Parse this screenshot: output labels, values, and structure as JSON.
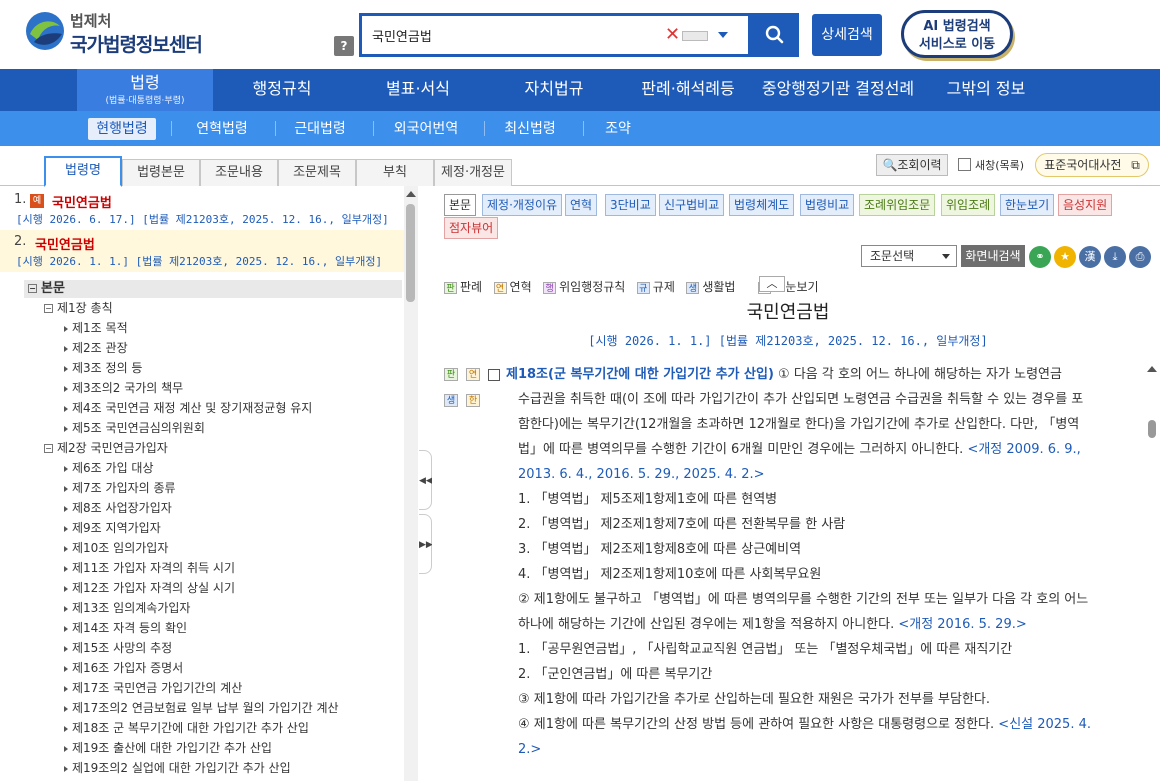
{
  "header": {
    "org": "법제처",
    "site_title": "국가법령정보센터",
    "help_label": "?",
    "search_value": "국민연금법",
    "detail_search_label": "상세검색",
    "ai_line1": "AI 법령검색",
    "ai_line2": "서비스로 이동"
  },
  "main_nav": [
    {
      "label": "법령",
      "sub": "(법률·대통령령·부령)"
    },
    {
      "label": "행정규칙"
    },
    {
      "label": "별표·서식"
    },
    {
      "label": "자치법규"
    },
    {
      "label": "판례·해석례등"
    },
    {
      "label": "중앙행정기관 결정선례"
    },
    {
      "label": "그밖의 정보"
    }
  ],
  "sub_nav": [
    "현행법령",
    "연혁법령",
    "근대법령",
    "외국어번역",
    "최신법령",
    "조약"
  ],
  "tabs": [
    "법령명",
    "법령본문",
    "조문내용",
    "조문제목",
    "부칙",
    "제정·개정문"
  ],
  "tools": {
    "history_label": "조회이력",
    "new_window_label": "새창(목록)",
    "std_dict_label": "표준국어대사전"
  },
  "results": [
    {
      "num": "1.",
      "badge": "예",
      "name": "국민연금법",
      "meta": "[시행 2026. 6. 17.] [법률 제21203호, 2025. 12. 16., 일부개정]"
    },
    {
      "num": "2.",
      "name": "국민연금법",
      "meta": "[시행 2026. 1. 1.] [법률 제21203호, 2025. 12. 16., 일부개정]"
    }
  ],
  "toc": {
    "head": "본문",
    "ch1": "제1장 총칙",
    "ch1_items": [
      "제1조 목적",
      "제2조 관장",
      "제3조 정의 등",
      "제3조의2 국가의 책무",
      "제4조 국민연금 재정 계산 및 장기재정균형 유지",
      "제5조 국민연금심의위원회"
    ],
    "ch2": "제2장 국민연금가입자",
    "ch2_items": [
      "제6조 가입 대상",
      "제7조 가입자의 종류",
      "제8조 사업장가입자",
      "제9조 지역가입자",
      "제10조 임의가입자",
      "제11조 가입자 자격의 취득 시기",
      "제12조 가입자 자격의 상실 시기",
      "제13조 임의계속가입자",
      "제14조 자격 등의 확인",
      "제15조 사망의 추정",
      "제16조 가입자 증명서",
      "제17조 국민연금 가입기간의 계산",
      "제17조의2 연금보험료 일부 납부 월의 가입기간 계산",
      "제18조 군 복무기간에 대한 가입기간 추가 산입",
      "제19조 출산에 대한 가입기간 추가 산입",
      "제19조의2 실업에 대한 가입기간 추가 산입"
    ]
  },
  "toolbar": {
    "row1": [
      "본문",
      "제정·개정이유",
      "연혁",
      "3단비교",
      "신구법비교",
      "법령체계도",
      "법령비교",
      "조례위임조문",
      "위임조례",
      "한눈보기",
      "음성지원"
    ],
    "row2": [
      "점자뷰어"
    ],
    "article_select": "조문선택",
    "inpage_search": "화면내검색",
    "hanja": "漢"
  },
  "legend": [
    {
      "icon": "판",
      "label": "판례"
    },
    {
      "icon": "연",
      "label": "연혁"
    },
    {
      "icon": "행",
      "label": "위임행정규칙"
    },
    {
      "icon": "규",
      "label": "규제"
    },
    {
      "icon": "생",
      "label": "생활법"
    },
    {
      "icon": "한",
      "label": "한눈보기"
    }
  ],
  "doc": {
    "title": "국민연금법",
    "meta": "[시행 2026. 1. 1.] [법률 제21203호, 2025. 12. 16., 일부개정]",
    "article_title": "제18조(군 복무기간에 대한 가입기간 추가 산입)",
    "p1_l1": "① 다음 각 호의 어느 하나에 해당하는 자가 노령연금",
    "p1_l2": "수급권을 취득한 때(이 조에 따라 가입기간이 추가 산입되면 노령연금 수급권을 취득할 수 있는 경우를 포",
    "p1_l3": "함한다)에는 복무기간(12개월을 초과하면 12개월로 한다)을 가입기간에 추가로 산입한다. 다만, 「병역",
    "p1_l4a": "법」에 따른 병역의무를 수행한 기간이 6개월 미만인 경우에는 그러하지 아니한다. ",
    "p1_l4b": "<개정 2009. 6. 9.,",
    "p1_l5": "2013. 6. 4., 2016. 5. 29., 2025. 4. 2.>",
    "i1": "1. 「병역법」 제5조제1항제1호에 따른 현역병",
    "i2": "2. 「병역법」 제2조제1항제7호에 따른 전환복무를 한 사람",
    "i3": "3. 「병역법」 제2조제1항제8호에 따른 상근예비역",
    "i4": "4. 「병역법」 제2조제1항제10호에 따른 사회복무요원",
    "p2_l1": "② 제1항에도 불구하고 「병역법」에 따른 병역의무를 수행한 기간의 전부 또는 일부가 다음 각 호의 어느",
    "p2_l2a": "하나에 해당하는 기간에 산입된 경우에는 제1항을 적용하지 아니한다. ",
    "p2_l2b": "<개정 2016. 5. 29.>",
    "j1": "1. 「공무원연금법」, 「사립학교교직원 연금법」 또는 「별정우체국법」에 따른 재직기간",
    "j2": "2. 「군인연금법」에 따른 복무기간",
    "p3": "③ 제1항에 따라 가입기간을 추가로 산입하는데 필요한 재원은 국가가 전부를 부담한다.",
    "p4a": "④ 제1항에 따른 복무기간의 산정 방법 등에 관하여 필요한 사항은 대통령령으로 정한다. ",
    "p4b": "<신설 2025. 4.",
    "p4c": "2.>"
  }
}
